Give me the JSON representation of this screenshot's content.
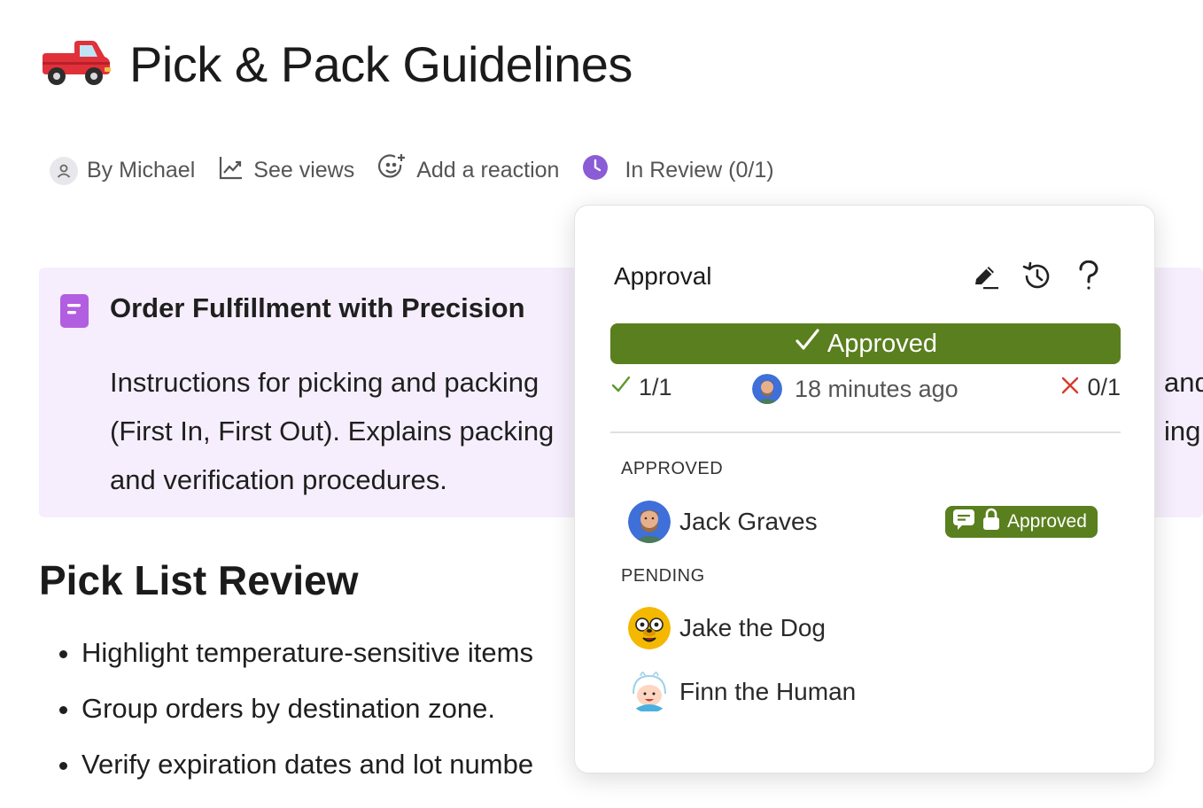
{
  "page": {
    "title": "Pick & Pack Guidelines",
    "title_icon": "pickup-truck-icon"
  },
  "meta": {
    "author": "By Michael",
    "views": "See views",
    "reaction": "Add a reaction",
    "status": "In Review (0/1)",
    "status_color": "#8a5cd6"
  },
  "callout": {
    "icon": "document-icon",
    "icon_color": "#b25ee0",
    "title": "Order Fulfillment with Precision",
    "body_lines": [
      "Instructions for picking and packing",
      "(First In, First Out). Explains packing",
      "and verification procedures."
    ],
    "body_tail_lines": [
      "and",
      "ing"
    ],
    "background": "#f6eefc"
  },
  "section": {
    "heading": "Pick List Review",
    "bullets": [
      "Highlight temperature-sensitive items",
      "Group orders by destination zone.",
      "Verify expiration dates and lot numbe"
    ]
  },
  "approval_popover": {
    "title": "Approval",
    "icons": [
      "edit-icon",
      "history-icon",
      "help-icon"
    ],
    "status_label": "Approved",
    "status_color": "#5a7f1e",
    "approved_count": "1/1",
    "approved_time": "18 minutes ago",
    "rejected_count": "0/1",
    "approved_section_label": "APPROVED",
    "pending_section_label": "PENDING",
    "approved_people": [
      {
        "name": "Jack Graves",
        "badge": "Approved"
      }
    ],
    "pending_people": [
      {
        "name": "Jake the Dog"
      },
      {
        "name": "Finn the Human"
      }
    ]
  }
}
